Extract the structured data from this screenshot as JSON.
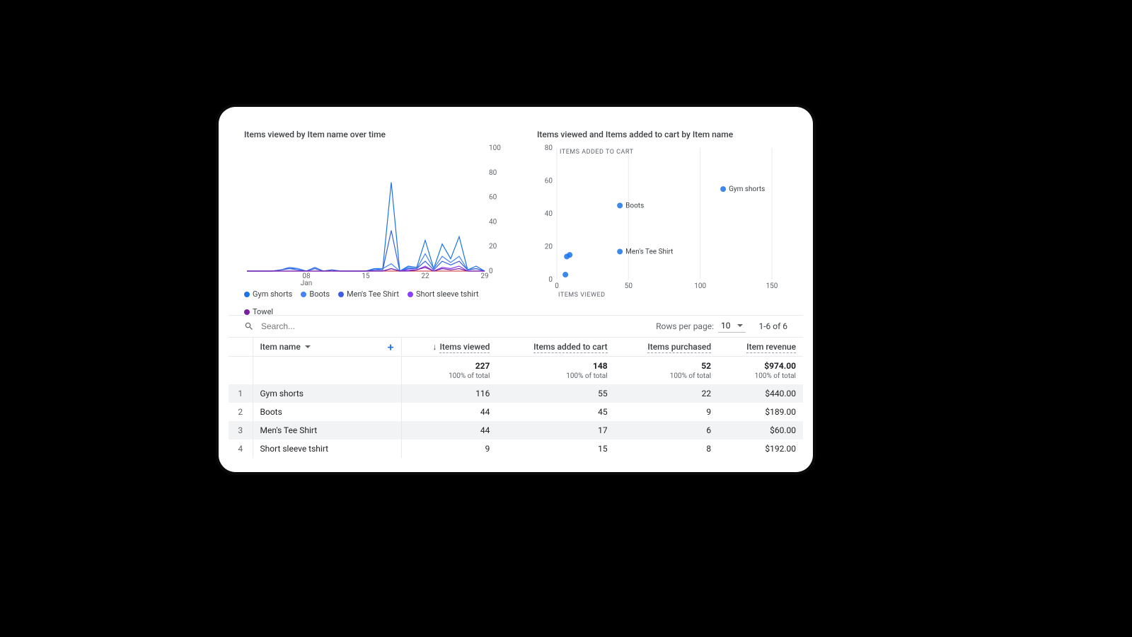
{
  "chart_data": [
    {
      "type": "line",
      "title": "Items viewed by Item name over time",
      "xlabel": "",
      "ylabel": "",
      "ylim": [
        0,
        100
      ],
      "x_ticks": [
        "08\nJan",
        "15",
        "22",
        "29"
      ],
      "x_days": [
        1,
        2,
        3,
        4,
        5,
        6,
        7,
        8,
        9,
        10,
        11,
        12,
        13,
        14,
        15,
        16,
        17,
        18,
        19,
        20,
        21,
        22,
        23,
        24,
        25,
        26,
        27,
        28,
        29
      ],
      "series": [
        {
          "name": "Gym shorts",
          "color": "#1a73e8",
          "values": [
            0,
            0,
            0,
            0,
            1,
            3,
            2,
            0,
            3,
            0,
            1,
            0,
            0,
            0,
            0,
            2,
            2,
            72,
            0,
            4,
            3,
            25,
            2,
            22,
            10,
            28,
            1,
            4,
            0
          ]
        },
        {
          "name": "Boots",
          "color": "#4285f4",
          "values": [
            0,
            0,
            0,
            0,
            1,
            2,
            2,
            0,
            3,
            0,
            1,
            0,
            0,
            0,
            0,
            1,
            2,
            6,
            0,
            3,
            2,
            14,
            2,
            12,
            7,
            12,
            1,
            2,
            0
          ]
        },
        {
          "name": "Men's Tee Shirt",
          "color": "#3b5fe2",
          "values": [
            0,
            0,
            0,
            0,
            1,
            2,
            1,
            0,
            2,
            0,
            1,
            0,
            0,
            0,
            0,
            1,
            1,
            33,
            0,
            2,
            2,
            8,
            1,
            8,
            5,
            8,
            1,
            2,
            0
          ]
        },
        {
          "name": "Short sleeve tshirt",
          "color": "#8a3ffc",
          "values": [
            0,
            0,
            0,
            0,
            0,
            0,
            0,
            0,
            0,
            0,
            0,
            0,
            0,
            0,
            0,
            0,
            0,
            2,
            0,
            1,
            1,
            4,
            0,
            3,
            2,
            4,
            0,
            0,
            0
          ]
        },
        {
          "name": "Towel",
          "color": "#7b1fa2",
          "values": [
            0,
            0,
            0,
            0,
            0,
            0,
            0,
            0,
            0,
            0,
            0,
            0,
            0,
            0,
            0,
            0,
            0,
            2,
            0,
            0,
            1,
            3,
            0,
            2,
            1,
            2,
            0,
            0,
            0
          ]
        }
      ]
    },
    {
      "type": "scatter",
      "title": "Items viewed and Items added to cart by Item name",
      "xlabel": "ITEMS VIEWED",
      "ylabel": "ITEMS ADDED TO CART",
      "xlim": [
        0,
        150
      ],
      "ylim": [
        0,
        80
      ],
      "x_ticks": [
        0,
        50,
        100,
        150
      ],
      "y_ticks": [
        0,
        20,
        40,
        60,
        80
      ],
      "points": [
        {
          "name": "Gym shorts",
          "x": 116,
          "y": 55,
          "label": "Gym shorts"
        },
        {
          "name": "Boots",
          "x": 44,
          "y": 45,
          "label": "Boots"
        },
        {
          "name": "Men's Tee Shirt",
          "x": 44,
          "y": 17,
          "label": "Men's Tee Shirt"
        },
        {
          "name": "Short sleeve tshirt",
          "x": 9,
          "y": 15,
          "label": ""
        },
        {
          "name": "Towel",
          "x": 7,
          "y": 14,
          "label": ""
        },
        {
          "name": "unnamed",
          "x": 6,
          "y": 3,
          "label": ""
        }
      ],
      "point_color": "#1a73e8"
    }
  ],
  "table": {
    "search_placeholder": "Search...",
    "rows_per_page_label": "Rows per page:",
    "rows_per_page_value": "10",
    "range_text": "1-6 of 6",
    "dimension_label": "Item name",
    "columns": [
      "Items viewed",
      "Items added to cart",
      "Items purchased",
      "Item revenue"
    ],
    "sorted_column_index": 0,
    "totals": {
      "values": [
        "227",
        "148",
        "52",
        "$974.00"
      ],
      "subs": [
        "100% of total",
        "100% of total",
        "100% of total",
        "100% of total"
      ]
    },
    "rows": [
      {
        "i": "1",
        "name": "Gym shorts",
        "v": [
          "116",
          "55",
          "22",
          "$440.00"
        ]
      },
      {
        "i": "2",
        "name": "Boots",
        "v": [
          "44",
          "45",
          "9",
          "$189.00"
        ]
      },
      {
        "i": "3",
        "name": "Men's Tee Shirt",
        "v": [
          "44",
          "17",
          "6",
          "$60.00"
        ]
      },
      {
        "i": "4",
        "name": "Short sleeve tshirt",
        "v": [
          "9",
          "15",
          "8",
          "$192.00"
        ]
      }
    ]
  }
}
